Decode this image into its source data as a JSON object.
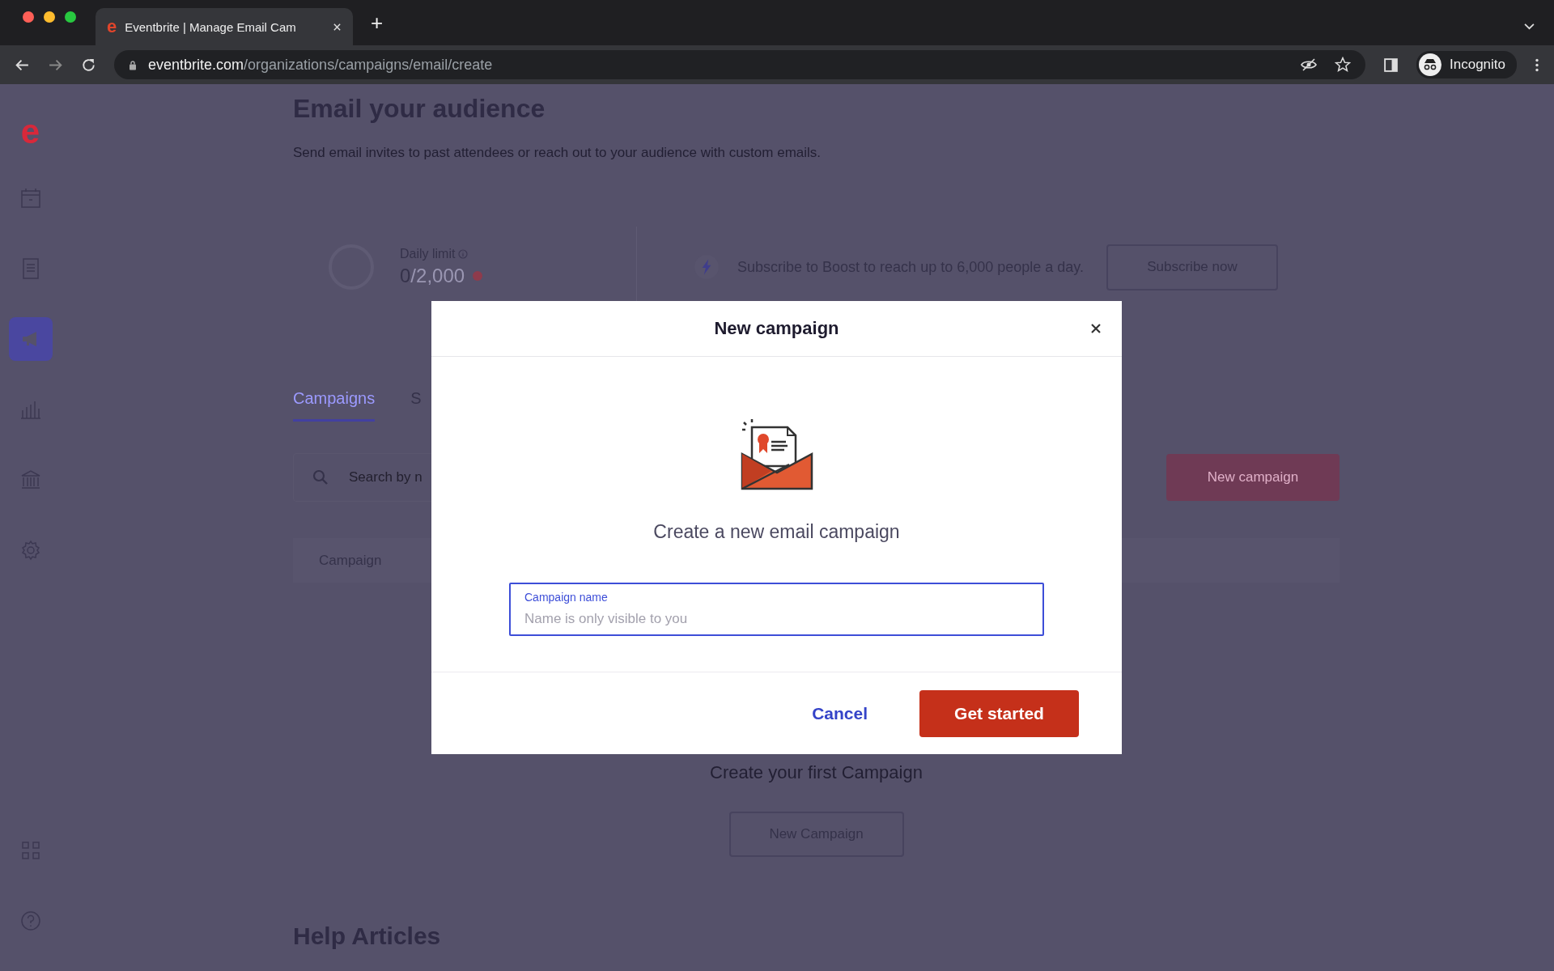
{
  "browser": {
    "favicon": "e",
    "tab_title": "Eventbrite | Manage Email Cam",
    "new_tab": "+",
    "url_host": "eventbrite.com",
    "url_path": "/organizations/campaigns/email/create",
    "profile": "Incognito"
  },
  "sidebar": {
    "logo": "e",
    "items": [
      {
        "kind": "calendar",
        "selected": false
      },
      {
        "kind": "list",
        "selected": false
      },
      {
        "kind": "megaphone",
        "selected": true
      },
      {
        "kind": "chart",
        "selected": false
      },
      {
        "kind": "bank",
        "selected": false
      },
      {
        "kind": "gear",
        "selected": false
      }
    ],
    "bottom_items": [
      {
        "kind": "apps"
      },
      {
        "kind": "help"
      }
    ]
  },
  "page": {
    "title": "Email your audience",
    "subtitle": "Send email invites to past attendees or reach out to your audience with custom emails.",
    "daily_limit": {
      "label": "Daily limit",
      "used": "0",
      "total": "/2,000"
    },
    "boost": {
      "text": "Subscribe to Boost to reach up to 6,000 people a day.",
      "button": "Subscribe now"
    },
    "tabs": [
      {
        "label": "Campaigns",
        "selected": true
      },
      {
        "label": "S",
        "selected": false
      }
    ],
    "search": {
      "placeholder": "Search by n"
    },
    "new_campaign_button": "New campaign",
    "table": {
      "columns": [
        "Campaign"
      ]
    },
    "empty_state": {
      "title": "Create your first Campaign",
      "button": "New Campaign"
    },
    "help_title": "Help Articles"
  },
  "modal": {
    "title": "New campaign",
    "heading": "Create a new email campaign",
    "field": {
      "label": "Campaign name",
      "placeholder": "Name is only visible to you"
    },
    "cancel": "Cancel",
    "confirm": "Get started"
  }
}
